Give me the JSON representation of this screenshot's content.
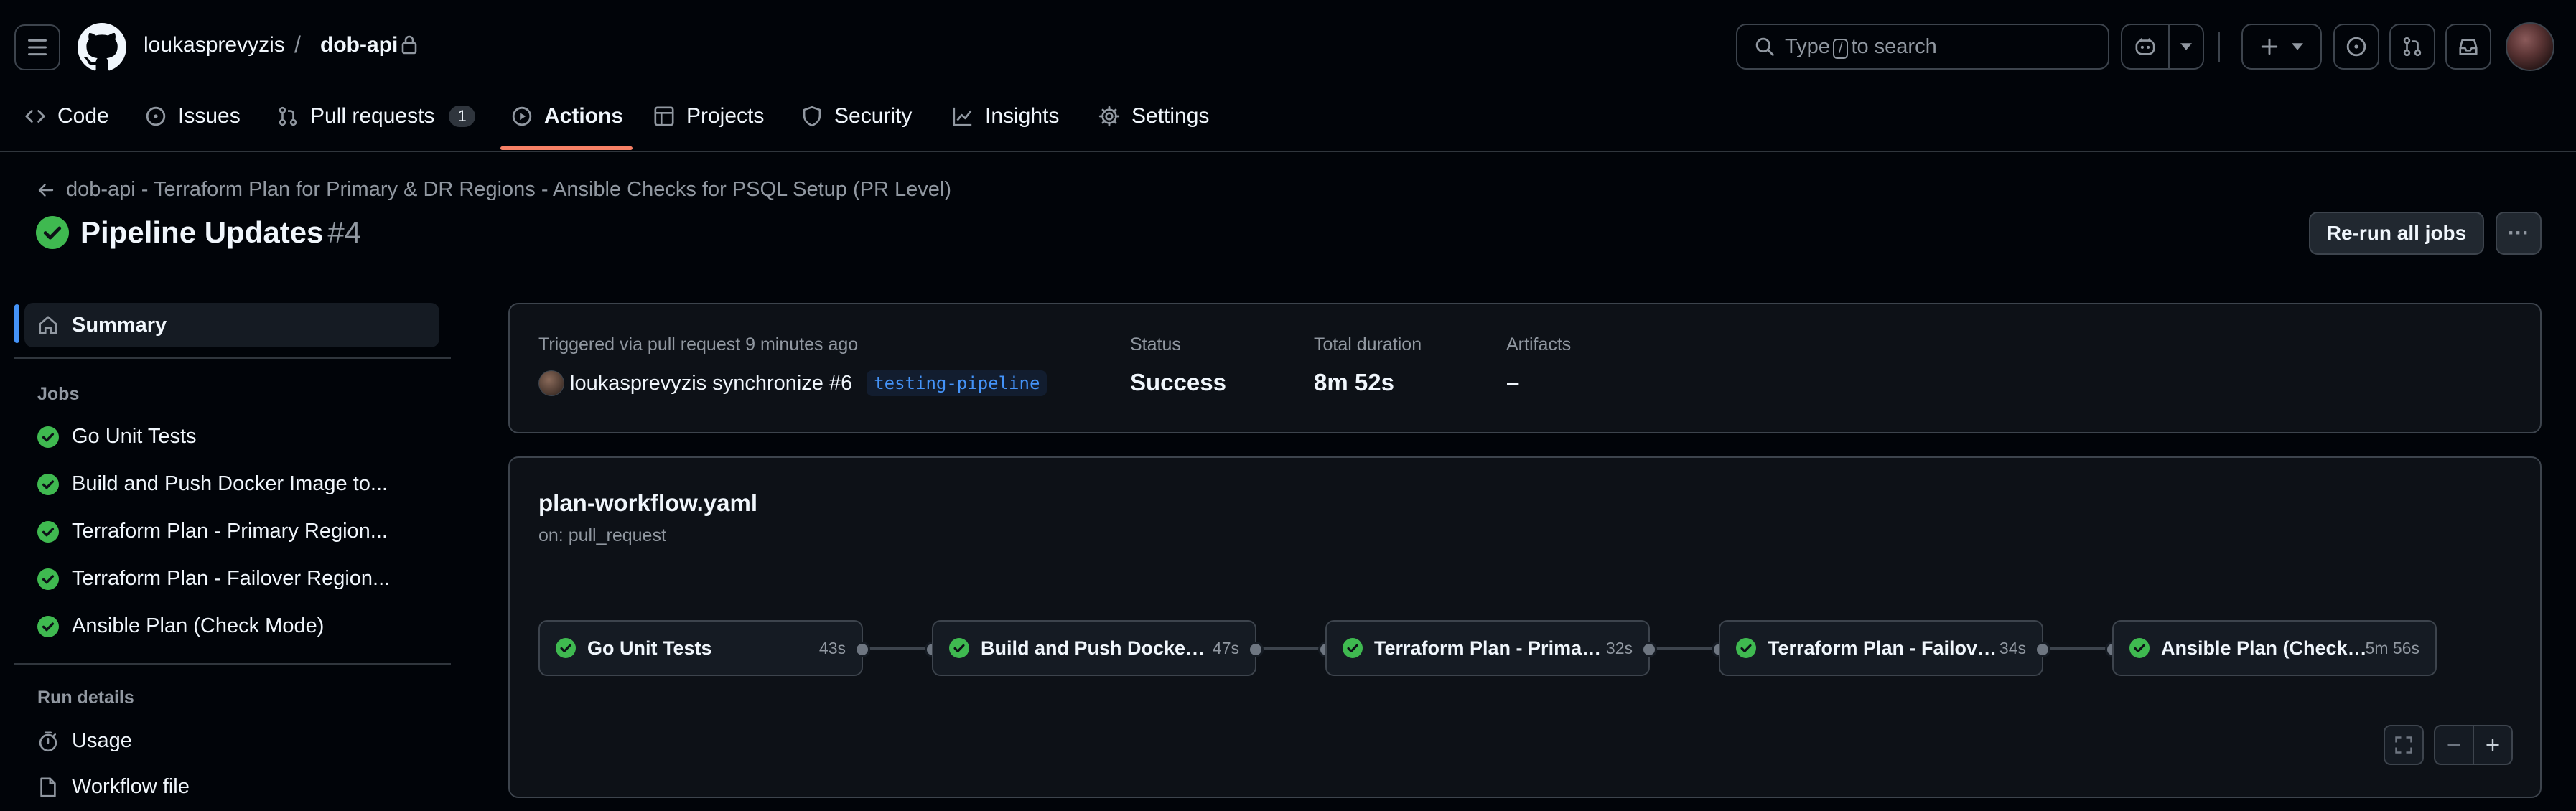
{
  "header": {
    "owner": "loukasprevyzis",
    "slash": "/",
    "repo": "dob-api",
    "search_prefix": "Type",
    "search_key": "/",
    "search_suffix": "to search"
  },
  "nav": {
    "code": "Code",
    "issues": "Issues",
    "pull_requests": "Pull requests",
    "pull_requests_count": "1",
    "actions": "Actions",
    "projects": "Projects",
    "security": "Security",
    "insights": "Insights",
    "settings": "Settings"
  },
  "run": {
    "back_label": "dob-api - Terraform Plan for Primary & DR Regions - Ansible Checks for PSQL Setup (PR Level)",
    "title": "Pipeline Updates",
    "number": "#4",
    "rerun_label": "Re-run all jobs",
    "more_label": "···"
  },
  "sidebar": {
    "summary": "Summary",
    "jobs_heading": "Jobs",
    "jobs": [
      "Go Unit Tests",
      "Build and Push Docker Image to...",
      "Terraform Plan - Primary Region...",
      "Terraform Plan - Failover Region...",
      "Ansible Plan (Check Mode)"
    ],
    "details_heading": "Run details",
    "usage": "Usage",
    "workflow_file": "Workflow file"
  },
  "summary_card": {
    "triggered": "Triggered via pull request 9 minutes ago",
    "actor": "loukasprevyzis",
    "action": "synchronize",
    "pr": "#6",
    "branch": "testing-pipeline",
    "status_label": "Status",
    "status_value": "Success",
    "duration_label": "Total duration",
    "duration_value": "8m 52s",
    "artifacts_label": "Artifacts",
    "artifacts_value": "–"
  },
  "workflow": {
    "file": "plan-workflow.yaml",
    "on": "on: pull_request",
    "jobs": [
      {
        "name": "Go Unit Tests",
        "time": "43s"
      },
      {
        "name": "Build and Push Docker Im...",
        "time": "47s"
      },
      {
        "name": "Terraform Plan - Primary ...",
        "time": "32s"
      },
      {
        "name": "Terraform Plan - Failover ...",
        "time": "34s"
      },
      {
        "name": "Ansible Plan (Check M...",
        "time": "5m 56s"
      }
    ]
  },
  "colors": {
    "success": "#3fb950",
    "accent": "#f78166",
    "link": "#4493f8"
  },
  "icons": [
    "hamburger-icon",
    "github-logo-icon",
    "lock-icon",
    "search-icon",
    "copilot-icon",
    "plus-icon",
    "issue-icon",
    "pull-request-icon",
    "inbox-icon",
    "code-icon",
    "play-icon",
    "table-icon",
    "shield-icon",
    "graph-icon",
    "gear-icon",
    "arrow-left-icon",
    "check-circle-icon",
    "home-icon",
    "stopwatch-icon",
    "file-icon",
    "fullscreen-icon",
    "minus-icon"
  ]
}
